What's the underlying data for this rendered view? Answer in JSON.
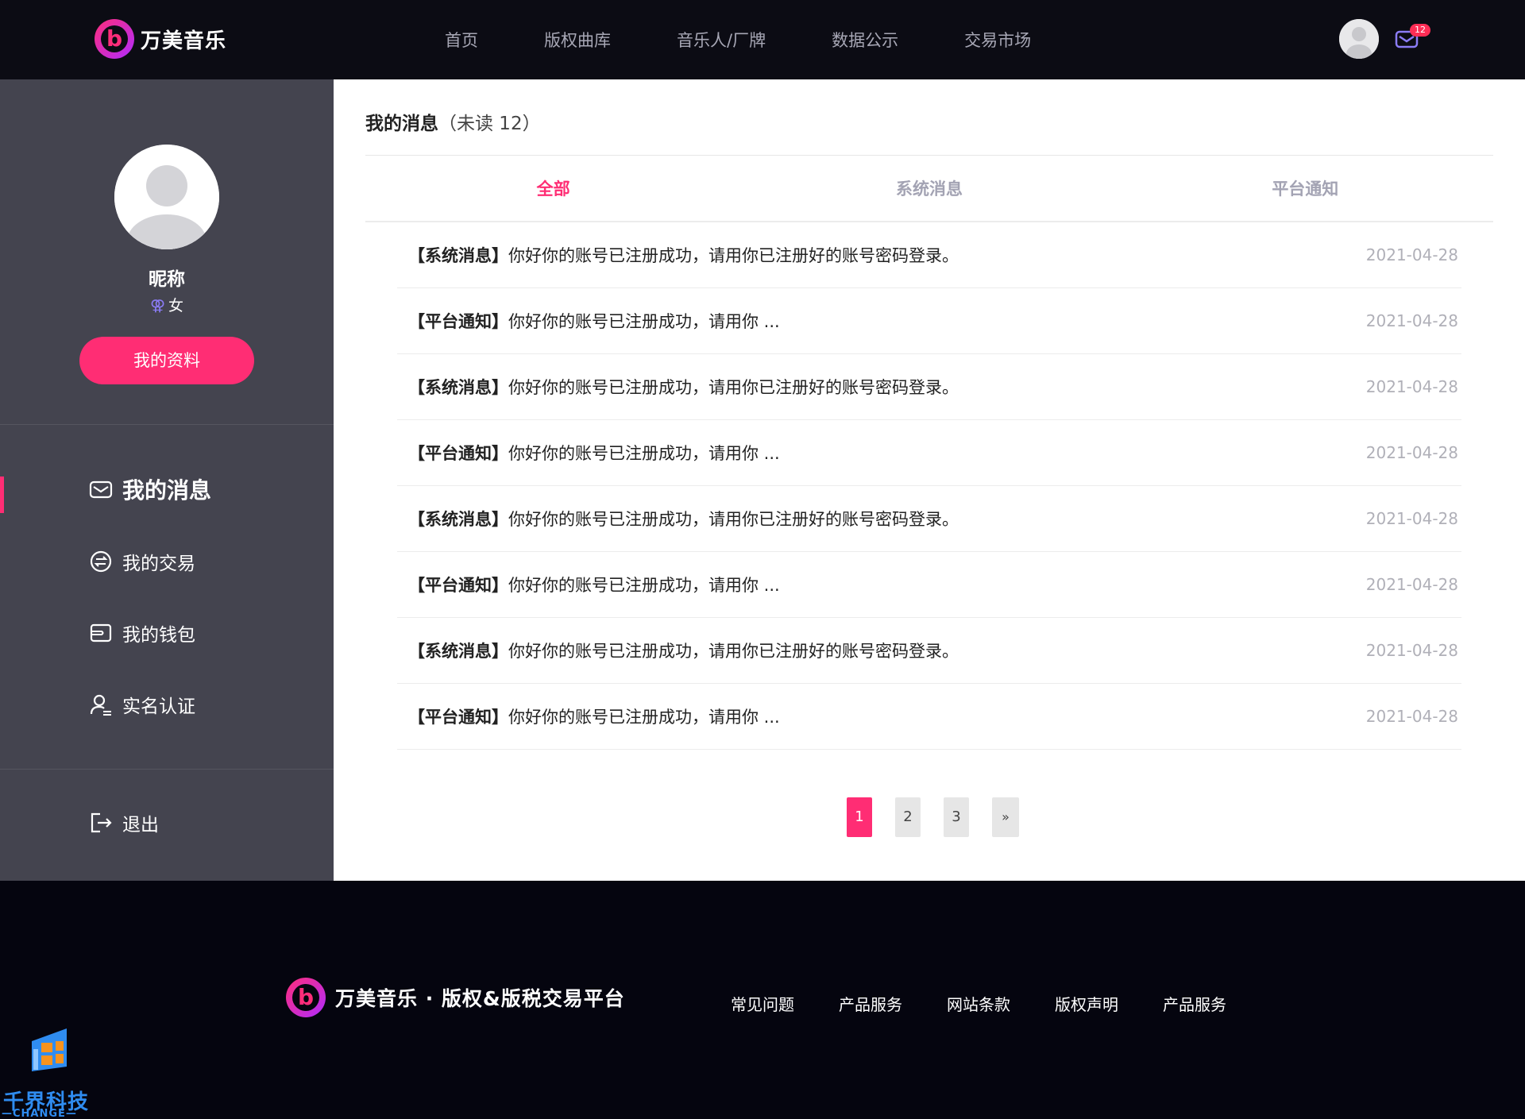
{
  "header": {
    "brand": "万美音乐",
    "nav": [
      "首页",
      "版权曲库",
      "音乐人/厂牌",
      "数据公示",
      "交易市场"
    ],
    "mail_count": "12"
  },
  "sidebar": {
    "nickname": "昵称",
    "gender_icon": "⚢",
    "gender": "女",
    "profile_button": "我的资料",
    "menu": [
      {
        "label": "我的消息",
        "icon": "mail-icon"
      },
      {
        "label": "我的交易",
        "icon": "exchange-icon"
      },
      {
        "label": "我的钱包",
        "icon": "wallet-icon"
      },
      {
        "label": "实名认证",
        "icon": "user-verify-icon"
      }
    ],
    "logout": "退出"
  },
  "main": {
    "title": "我的消息",
    "unread": "（未读 12）",
    "tabs": [
      "全部",
      "系统消息",
      "平台通知"
    ],
    "messages": [
      {
        "tag": "【系统消息】",
        "text": "你好你的账号已注册成功，请用你已注册好的账号密码登录。",
        "date": "2021-04-28"
      },
      {
        "tag": "【平台通知】",
        "text": "你好你的账号已注册成功，请用你 ...",
        "date": "2021-04-28"
      },
      {
        "tag": "【系统消息】",
        "text": "你好你的账号已注册成功，请用你已注册好的账号密码登录。",
        "date": "2021-04-28"
      },
      {
        "tag": "【平台通知】",
        "text": "你好你的账号已注册成功，请用你 ...",
        "date": "2021-04-28"
      },
      {
        "tag": "【系统消息】",
        "text": "你好你的账号已注册成功，请用你已注册好的账号密码登录。",
        "date": "2021-04-28"
      },
      {
        "tag": "【平台通知】",
        "text": "你好你的账号已注册成功，请用你 ...",
        "date": "2021-04-28"
      },
      {
        "tag": "【系统消息】",
        "text": "你好你的账号已注册成功，请用你已注册好的账号密码登录。",
        "date": "2021-04-28"
      },
      {
        "tag": "【平台通知】",
        "text": "你好你的账号已注册成功，请用你 ...",
        "date": "2021-04-28"
      }
    ],
    "pages": [
      "1",
      "2",
      "3"
    ],
    "next_page": "»"
  },
  "footer": {
    "brand": "万美音乐 · 版权&版税交易平台",
    "links": [
      "常见问题",
      "产品服务",
      "网站条款",
      "版权声明",
      "产品服务"
    ]
  },
  "watermark": {
    "text": "千界科技",
    "sub": "—CHANGE—"
  },
  "colors": {
    "accent": "#ff2d74",
    "header_bg": "#0c0c14",
    "sidebar_bg": "#44444f"
  }
}
